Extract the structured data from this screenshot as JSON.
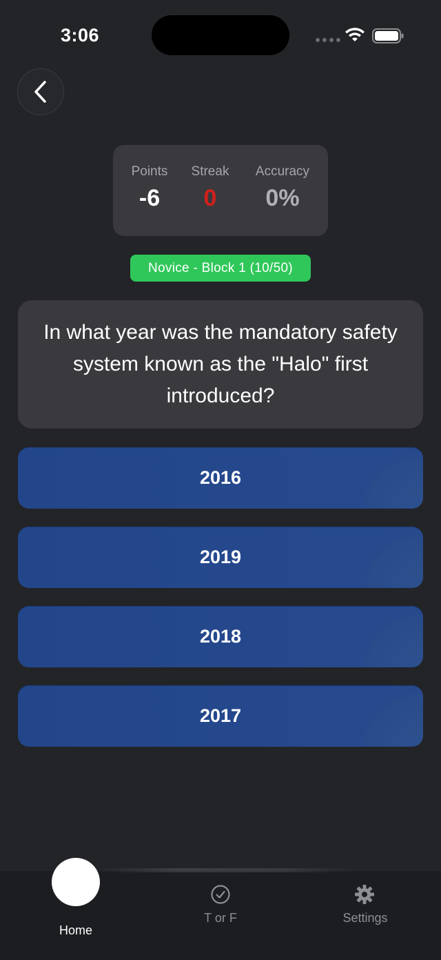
{
  "status": {
    "time": "3:06"
  },
  "stats": {
    "points_label": "Points",
    "points_value": "-6",
    "streak_label": "Streak",
    "streak_value": "0",
    "accuracy_label": "Accuracy",
    "accuracy_value": "0%"
  },
  "level_badge": "Novice - Block 1 (10/50)",
  "question": "In what year was the mandatory safety system known as the \"Halo\" first introduced?",
  "answers": [
    "2016",
    "2019",
    "2018",
    "2017"
  ],
  "tabs": [
    {
      "label": "Home",
      "icon": "home-circle"
    },
    {
      "label": "T or F",
      "icon": "checkmark-circle-icon"
    },
    {
      "label": "Settings",
      "icon": "gear-icon"
    }
  ],
  "colors": {
    "background": "#232428",
    "card": "#3a3a3e",
    "badge_green": "#30c75a",
    "answer_blue": "#26498e",
    "streak_red": "#d0201c",
    "accuracy_gray": "#b0b1b5"
  }
}
